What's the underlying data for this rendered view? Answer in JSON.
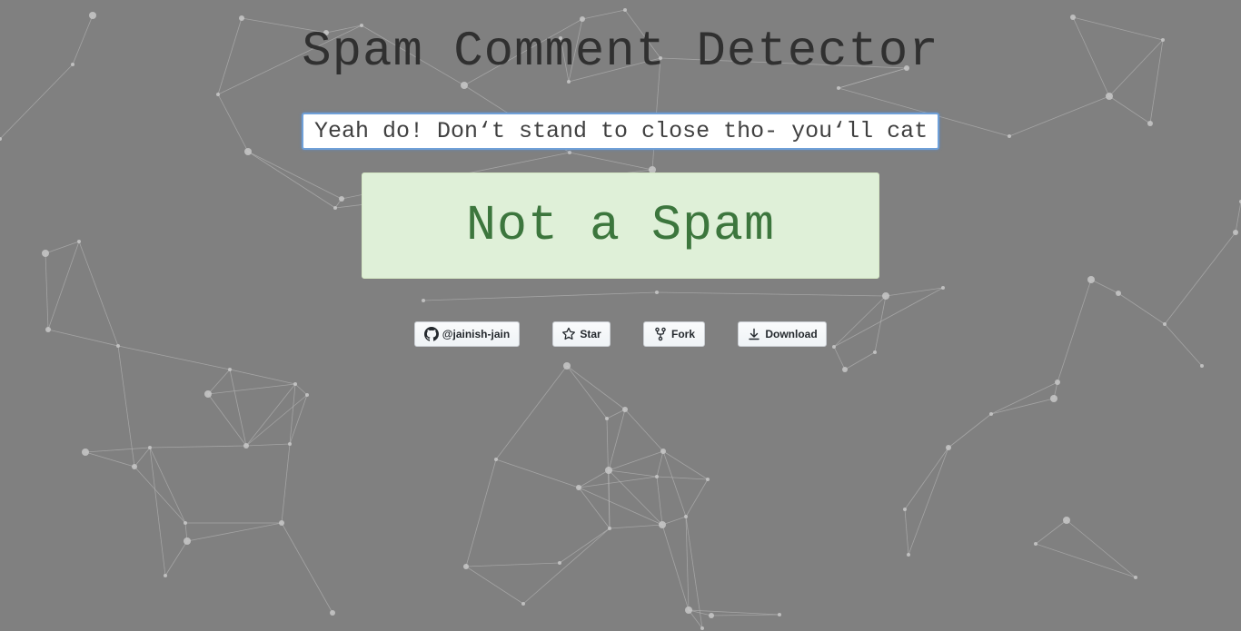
{
  "page": {
    "title": "Spam Comment Detector"
  },
  "comment": {
    "value": "Yeah do! Don‘t stand to close tho- you‘ll catch it"
  },
  "result": {
    "label": "Not a Spam"
  },
  "github_buttons": {
    "follow_label": "@jainish-jain",
    "star_label": "Star",
    "fork_label": "Fork",
    "download_label": "Download"
  },
  "colors": {
    "background": "#808080",
    "title": "#303030",
    "result_bg": "#dff0d8",
    "result_text": "#3c763d",
    "network_lines": "#b4b4b4"
  },
  "icons": {
    "follow": "github-mark-icon",
    "star": "star-icon",
    "fork": "repo-fork-icon",
    "download": "download-icon"
  }
}
